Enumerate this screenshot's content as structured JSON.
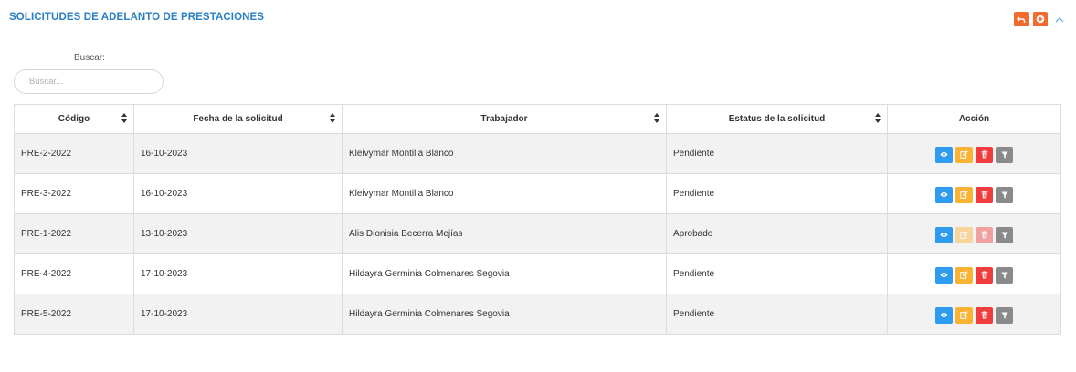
{
  "header": {
    "title": "SOLICITUDES DE ADELANTO DE PRESTACIONES"
  },
  "top_actions": [
    {
      "name": "back-button",
      "icon": "undo-arrow-icon"
    },
    {
      "name": "add-button",
      "icon": "plus-circle-icon"
    },
    {
      "name": "collapse-button",
      "icon": "chevron-up-icon"
    }
  ],
  "search": {
    "label": "Buscar:",
    "placeholder": "Buscar...",
    "value": ""
  },
  "table": {
    "columns": [
      "Código",
      "Fecha de la solicitud",
      "Trabajador",
      "Estatus de la solicitud",
      "Acción"
    ],
    "rows": [
      {
        "codigo": "PRE-2-2022",
        "fecha": "16-10-2023",
        "trabajador": "Kleivymar Montilla Blanco",
        "estatus": "Pendiente",
        "edit_enabled": true,
        "delete_enabled": true
      },
      {
        "codigo": "PRE-3-2022",
        "fecha": "16-10-2023",
        "trabajador": "Kleivymar Montilla Blanco",
        "estatus": "Pendiente",
        "edit_enabled": true,
        "delete_enabled": true
      },
      {
        "codigo": "PRE-1-2022",
        "fecha": "13-10-2023",
        "trabajador": "Alis Dionisia Becerra Mejías",
        "estatus": "Aprobado",
        "edit_enabled": false,
        "delete_enabled": false
      },
      {
        "codigo": "PRE-4-2022",
        "fecha": "17-10-2023",
        "trabajador": "Hildayra Germinia Colmenares Segovia",
        "estatus": "Pendiente",
        "edit_enabled": true,
        "delete_enabled": true
      },
      {
        "codigo": "PRE-5-2022",
        "fecha": "17-10-2023",
        "trabajador": "Hildayra Germinia Colmenares Segovia",
        "estatus": "Pendiente",
        "edit_enabled": true,
        "delete_enabled": true
      }
    ],
    "row_action_icons": [
      "eye-icon",
      "edit-icon",
      "trash-icon",
      "filter-icon"
    ]
  },
  "colors": {
    "title": "#2a7fc4",
    "top_button": "#f26a2e",
    "view": "#2d9bf0",
    "edit": "#f9b234",
    "delete": "#f03c3c",
    "filter": "#8a8a8a",
    "striped_row": "#f2f2f2"
  }
}
